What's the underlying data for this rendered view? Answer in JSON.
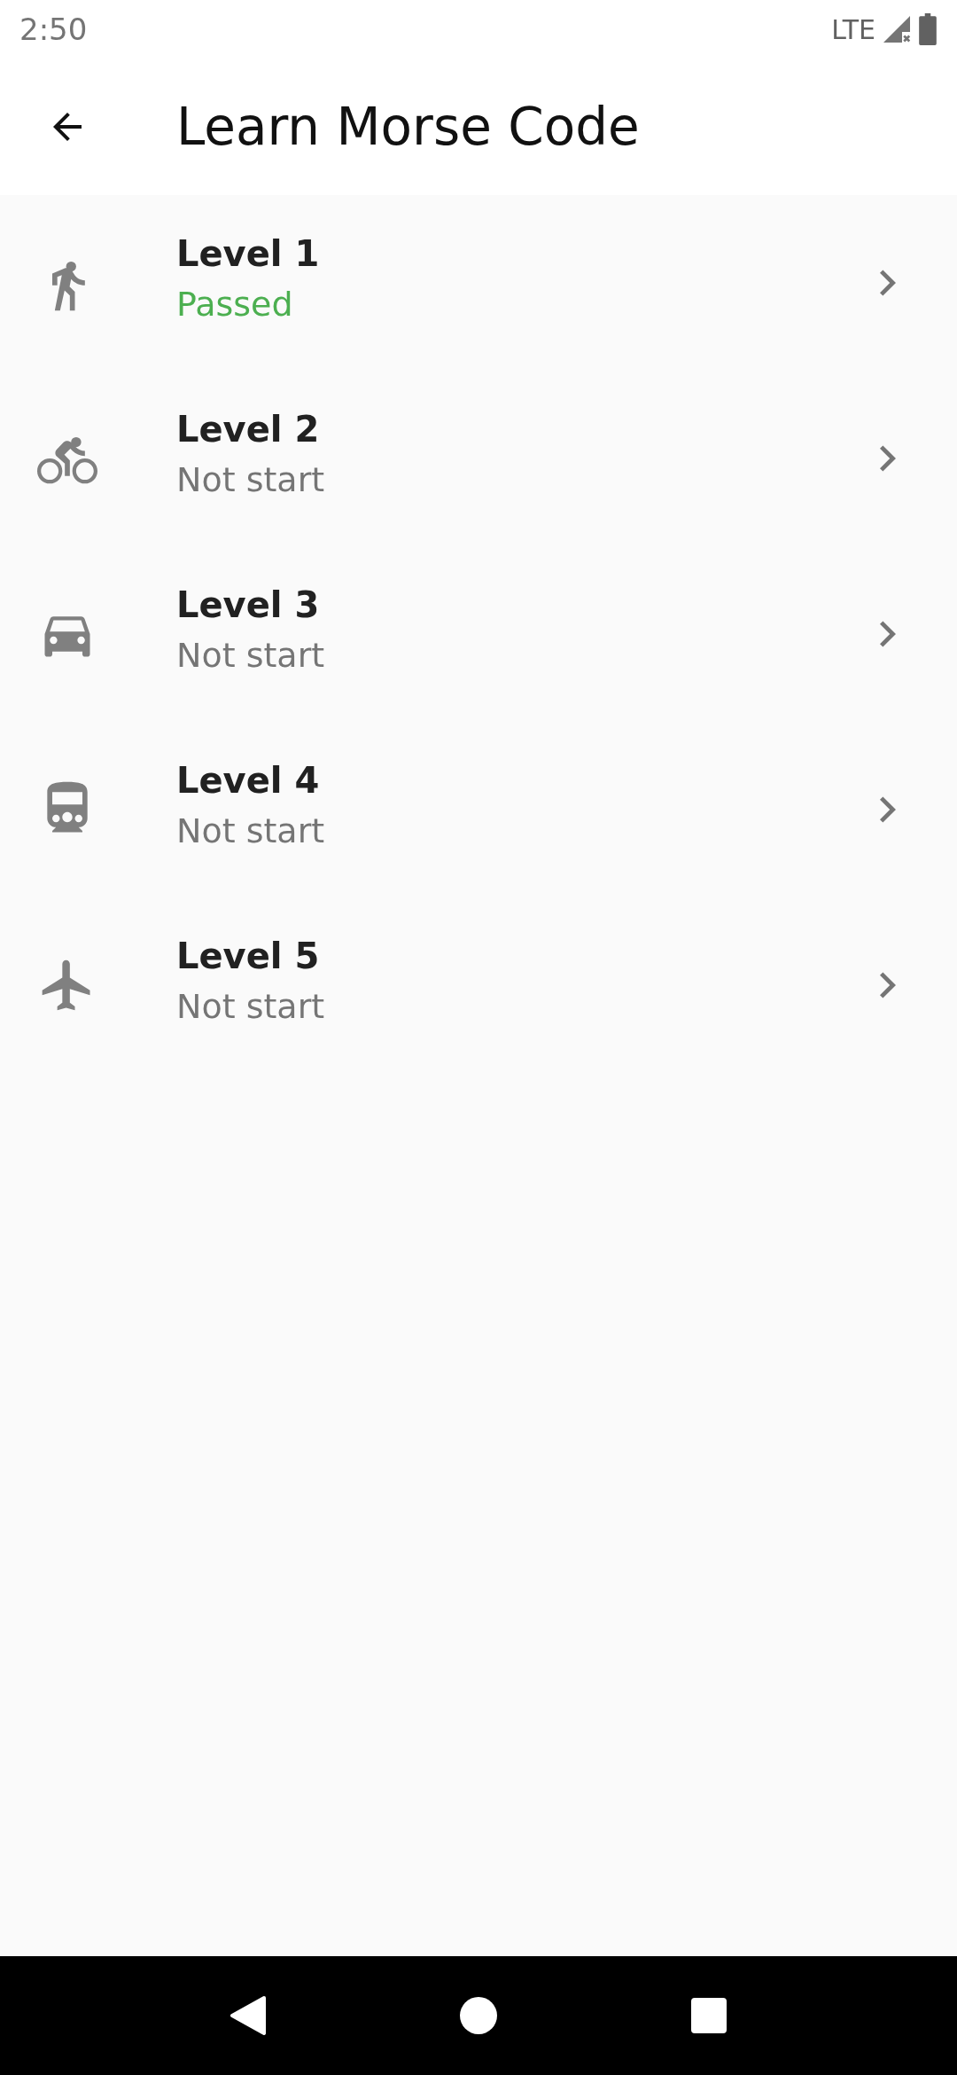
{
  "status_bar": {
    "time": "2:50",
    "network": "LTE"
  },
  "app_bar": {
    "title": "Learn Morse Code"
  },
  "levels": [
    {
      "kind": "walk",
      "title": "Level 1",
      "status": "Passed",
      "passed": true
    },
    {
      "kind": "bike",
      "title": "Level 2",
      "status": "Not start",
      "passed": false
    },
    {
      "kind": "car",
      "title": "Level 3",
      "status": "Not start",
      "passed": false
    },
    {
      "kind": "train",
      "title": "Level 4",
      "status": "Not start",
      "passed": false
    },
    {
      "kind": "plane",
      "title": "Level 5",
      "status": "Not start",
      "passed": false
    }
  ]
}
